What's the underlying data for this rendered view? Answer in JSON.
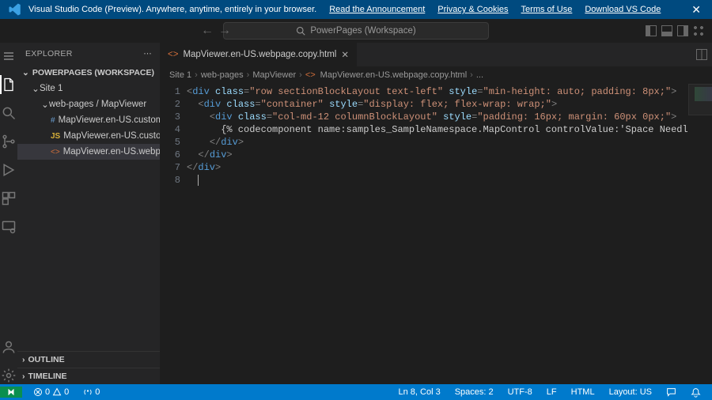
{
  "banner": {
    "text": "Visual Studio Code (Preview). Anywhere, anytime, entirely in your browser.",
    "links": [
      "Read the Announcement",
      "Privacy & Cookies",
      "Terms of Use",
      "Download VS Code"
    ]
  },
  "search_placeholder": "PowerPages (Workspace)",
  "sidebar": {
    "title": "EXPLORER",
    "section": "POWERPAGES (WORKSPACE)",
    "tree": {
      "root": "Site 1",
      "folder": "web-pages / MapViewer",
      "files": [
        {
          "icon": "hash",
          "name": "MapViewer.en-US.customc..."
        },
        {
          "icon": "js",
          "name": "MapViewer.en-US.customj..."
        },
        {
          "icon": "html",
          "name": "MapViewer.en-US.webpag..."
        }
      ]
    },
    "outline": "OUTLINE",
    "timeline": "TIMELINE"
  },
  "tab": {
    "icon": "html",
    "label": "MapViewer.en-US.webpage.copy.html"
  },
  "breadcrumbs": [
    "Site 1",
    "web-pages",
    "MapViewer",
    "MapViewer.en-US.webpage.copy.html",
    "..."
  ],
  "code": {
    "lines": [
      1,
      2,
      3,
      4,
      5,
      6,
      7,
      8
    ],
    "l1": {
      "class1": "row sectionBlockLayout text-left",
      "style1": "min-height: auto; padding: 8px;"
    },
    "l2": {
      "class1": "container",
      "style1": "display: flex; flex-wrap: wrap;"
    },
    "l3": {
      "class1": "col-md-12 columnBlockLayout",
      "style1": "padding: 16px; margin: 60px 0px;"
    },
    "l4": "      {% codecomponent name:samples_SampleNamespace.MapControl controlValue:'Space Needl",
    "close_div": "div"
  },
  "status": {
    "errors": "0",
    "warnings": "0",
    "ports": "0",
    "cursor": "Ln 8, Col 3",
    "spaces": "Spaces: 2",
    "encoding": "UTF-8",
    "eol": "LF",
    "lang": "HTML",
    "layout": "Layout: US"
  }
}
